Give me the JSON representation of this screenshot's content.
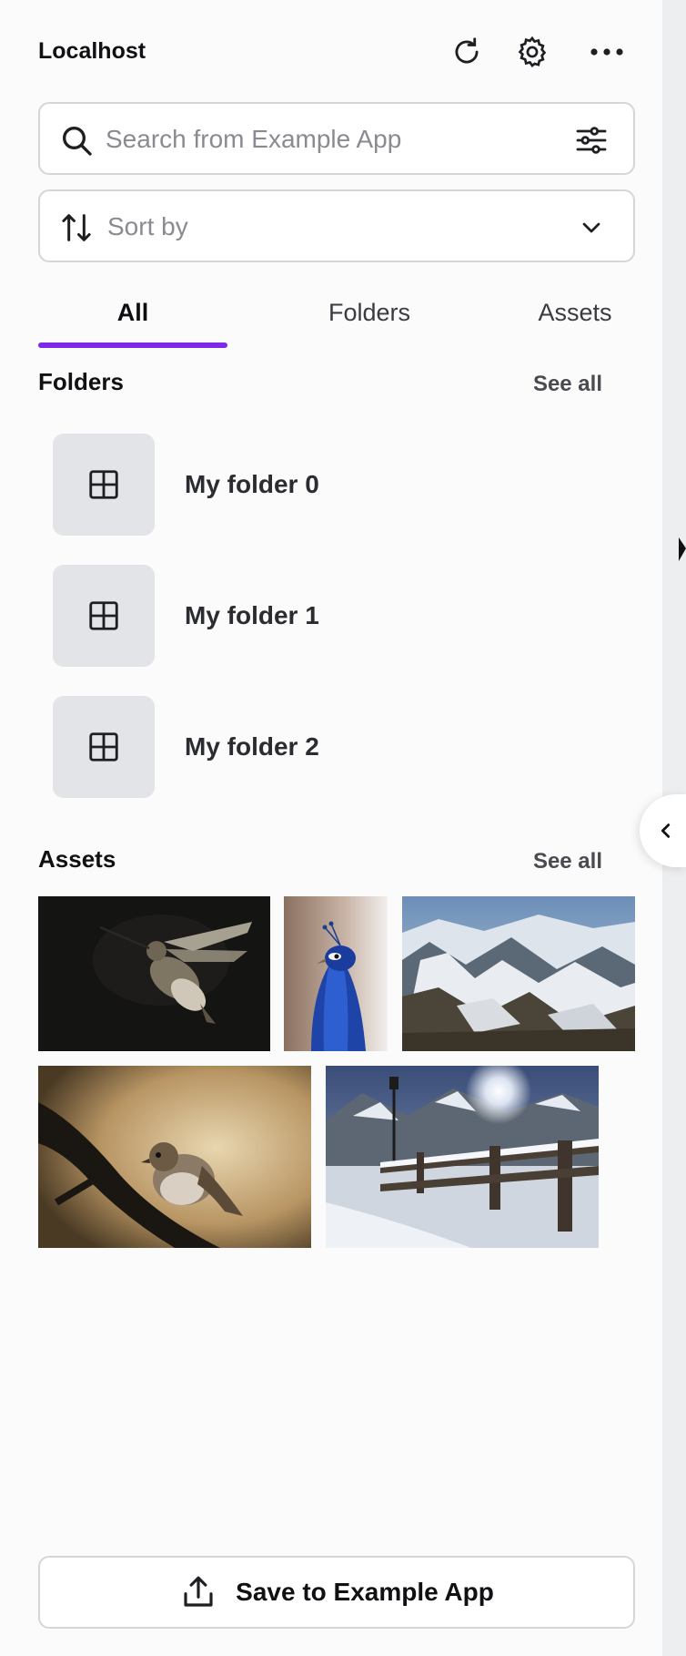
{
  "app": {
    "title": "Localhost"
  },
  "header_icons": [
    "refresh-icon",
    "gear-icon",
    "more-icon"
  ],
  "search": {
    "placeholder": "Search from Example App",
    "filter_icon": "sliders-icon"
  },
  "sort": {
    "placeholder": "Sort by",
    "icon": "sort-arrows-icon",
    "chevron": "chevron-down-icon"
  },
  "tabs": [
    {
      "label": "All",
      "active": true
    },
    {
      "label": "Folders",
      "active": false
    },
    {
      "label": "Assets",
      "active": false
    }
  ],
  "folders_section": {
    "title": "Folders",
    "see_all": "See all",
    "items": [
      {
        "label": "My folder 0",
        "icon": "grid-icon"
      },
      {
        "label": "My folder 1",
        "icon": "grid-icon"
      },
      {
        "label": "My folder 2",
        "icon": "grid-icon"
      }
    ]
  },
  "assets_section": {
    "title": "Assets",
    "see_all": "See all",
    "items": [
      {
        "subject": "hummingbird"
      },
      {
        "subject": "peacock"
      },
      {
        "subject": "snowy mountains"
      },
      {
        "subject": "sparrow on branch"
      },
      {
        "subject": "snowy fence with sun"
      }
    ]
  },
  "footer": {
    "save_label": "Save to Example App",
    "icon": "upload-icon"
  },
  "colors": {
    "accent": "#7d2ae8",
    "panel_bg": "#fbfbfc",
    "border": "#d5d6da"
  }
}
